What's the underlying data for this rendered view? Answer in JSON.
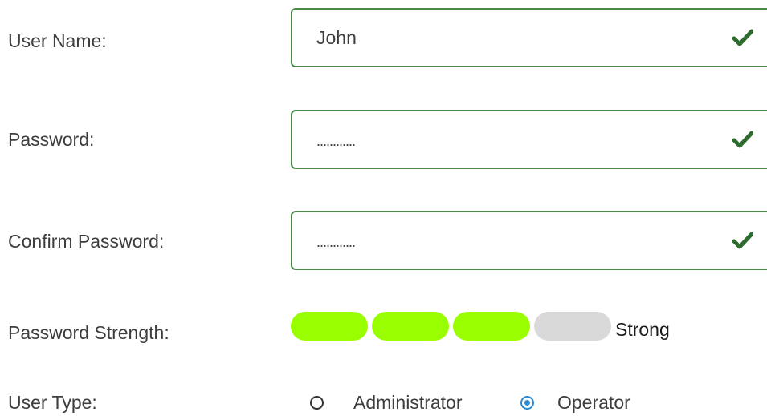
{
  "form": {
    "user_name": {
      "label": "User Name:",
      "value": "John",
      "valid_icon": "check-icon"
    },
    "password": {
      "label": "Password:",
      "masked_value": "............",
      "valid_icon": "check-icon"
    },
    "confirm_password": {
      "label": "Confirm Password:",
      "masked_value": "............",
      "valid_icon": "check-icon"
    },
    "password_strength": {
      "label": "Password Strength:",
      "level": 3,
      "max_level": 4,
      "text": "Strong"
    },
    "user_type": {
      "label": "User Type:",
      "options": [
        {
          "label": "Administrator",
          "selected": false
        },
        {
          "label": "Operator",
          "selected": true
        }
      ]
    }
  },
  "colors": {
    "field_border_valid": "#4a8a4a",
    "check_icon": "#2e6b2e",
    "strength_filled": "#99ff00",
    "strength_empty": "#d9d9d9",
    "radio_selected": "#2a8ad2"
  }
}
